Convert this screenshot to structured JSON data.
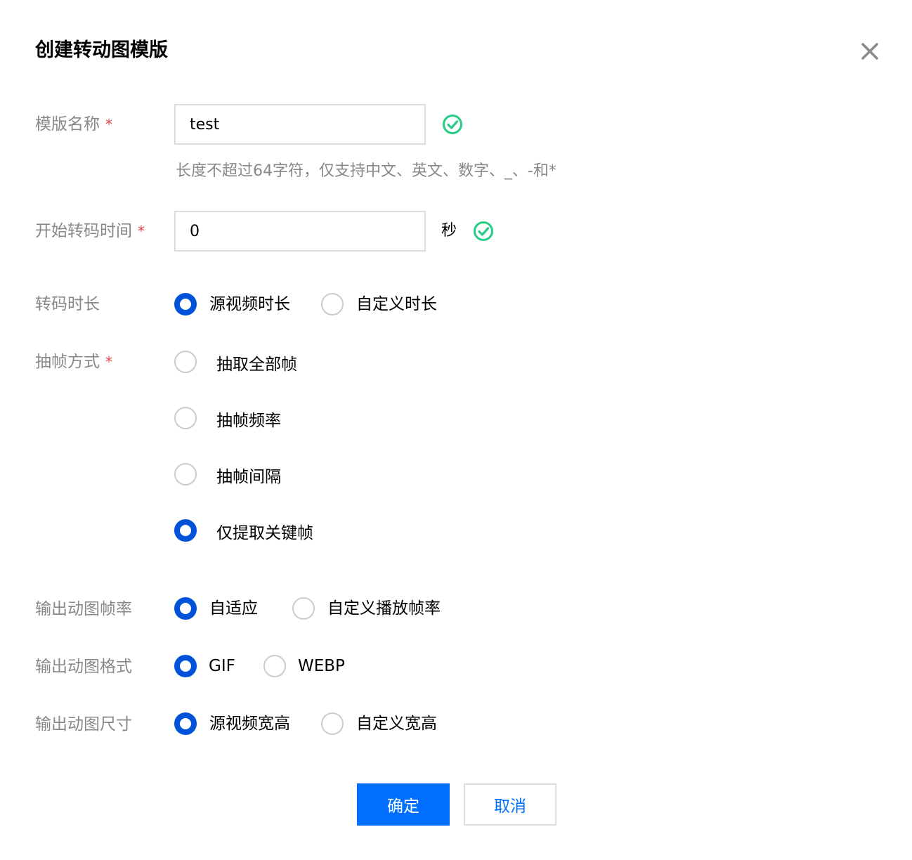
{
  "dialog": {
    "title": "创建转动图模版",
    "close_icon": "close-icon"
  },
  "colors": {
    "primary": "#006eff",
    "radio_selected": "#0052d9",
    "success": "#29cc85",
    "required": "#e54545",
    "label": "#888888"
  },
  "fields": {
    "template_name": {
      "label": "模版名称",
      "required": "*",
      "value": "test",
      "valid_icon": "check-circle-icon",
      "help": "长度不超过64字符，仅支持中文、英文、数字、_、-和*"
    },
    "start_time": {
      "label": "开始转码时间",
      "required": "*",
      "value": "0",
      "unit": "秒",
      "valid_icon": "check-circle-icon"
    },
    "duration": {
      "label": "转码时长",
      "options": [
        {
          "label": "源视频时长",
          "selected": true
        },
        {
          "label": "自定义时长",
          "selected": false
        }
      ]
    },
    "frame_extraction": {
      "label": "抽帧方式",
      "required": "*",
      "options": [
        {
          "label": "抽取全部帧",
          "selected": false
        },
        {
          "label": "抽帧频率",
          "selected": false
        },
        {
          "label": "抽帧间隔",
          "selected": false
        },
        {
          "label": "仅提取关键帧",
          "selected": true
        }
      ]
    },
    "output_fps": {
      "label": "输出动图帧率",
      "options": [
        {
          "label": "自适应",
          "selected": true
        },
        {
          "label": "自定义播放帧率",
          "selected": false
        }
      ]
    },
    "output_format": {
      "label": "输出动图格式",
      "options": [
        {
          "label": "GIF",
          "selected": true
        },
        {
          "label": "WEBP",
          "selected": false
        }
      ]
    },
    "output_size": {
      "label": "输出动图尺寸",
      "options": [
        {
          "label": "源视频宽高",
          "selected": true
        },
        {
          "label": "自定义宽高",
          "selected": false
        }
      ]
    }
  },
  "buttons": {
    "confirm": "确定",
    "cancel": "取消"
  }
}
